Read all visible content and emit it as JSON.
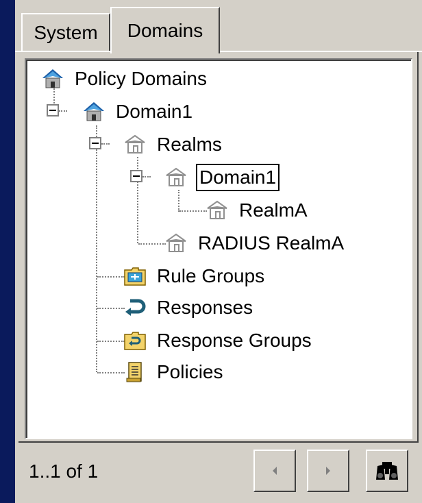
{
  "tabs": [
    {
      "label": "System",
      "active": false
    },
    {
      "label": "Domains",
      "active": true
    }
  ],
  "tree": {
    "root": {
      "label": "Policy Domains",
      "icon": "house-icon"
    },
    "domain": {
      "label": "Domain1",
      "icon": "house-icon",
      "expanded": true
    },
    "realms": {
      "label": "Realms",
      "icon": "realm-icon",
      "expanded": true
    },
    "realm_domain": {
      "label": "Domain1",
      "icon": "realm-icon",
      "expanded": true,
      "selected": true
    },
    "realm_a": {
      "label": "RealmA",
      "icon": "realm-icon"
    },
    "radius_realm": {
      "label": "RADIUS RealmA",
      "icon": "realm-icon"
    },
    "rule_groups": {
      "label": "Rule Groups",
      "icon": "rule-group-folder-icon"
    },
    "responses": {
      "label": "Responses",
      "icon": "response-arrow-icon"
    },
    "response_groups": {
      "label": "Response Groups",
      "icon": "response-group-folder-icon"
    },
    "policies": {
      "label": "Policies",
      "icon": "policy-scroll-icon"
    }
  },
  "footer": {
    "status": "1..1 of 1",
    "prev_icon": "arrow-left-icon",
    "next_icon": "arrow-right-icon",
    "find_icon": "binoculars-icon"
  },
  "colors": {
    "background": "#0a1a5c",
    "panel": "#d4d0c8",
    "tree_background": "#ffffff"
  }
}
